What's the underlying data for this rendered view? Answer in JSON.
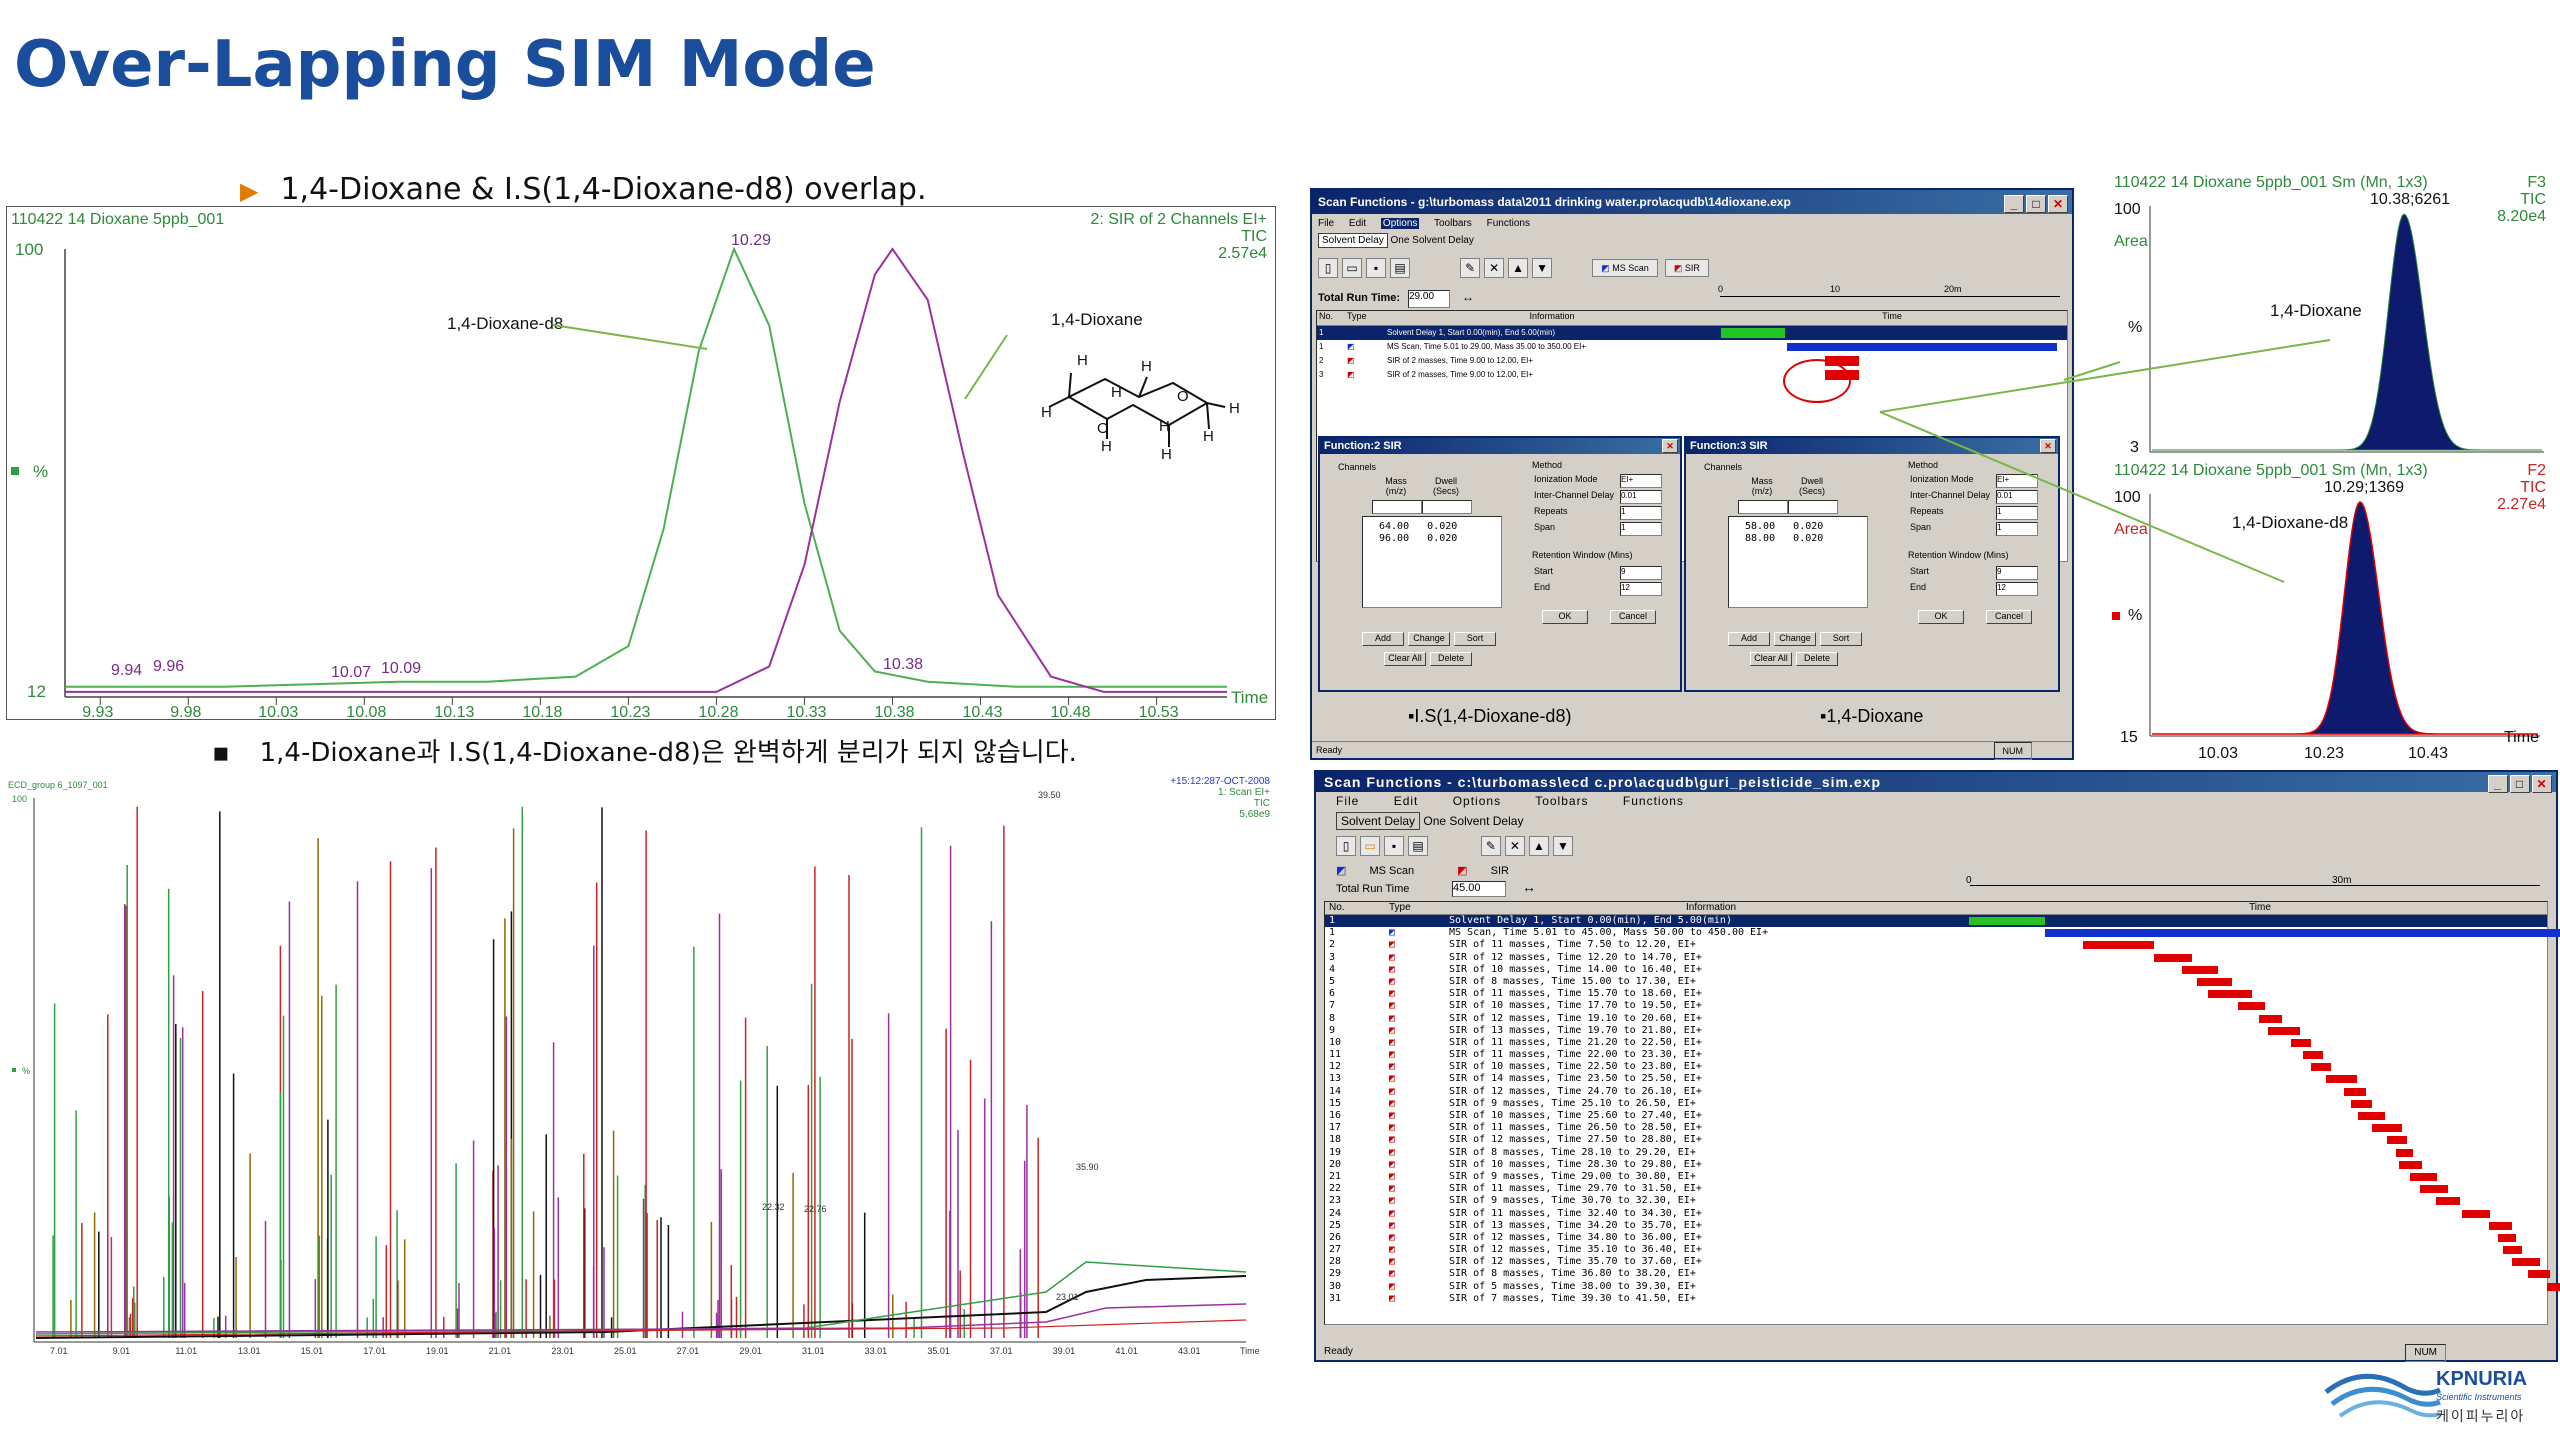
{
  "title": "Over-Lapping SIM Mode",
  "bullet1": "1,4-Dioxane & I.S(1,4-Dioxane-d8) overlap.",
  "bullet2": "1,4-Dioxane과 I.S(1,4-Dioxane-d8)은 완벽하게 분리가 되지 않습니다.",
  "colors": {
    "title": "#1a4d9c",
    "green": "#4caf50",
    "purple": "#9b30a0",
    "navy": "#0d1a6e",
    "red": "#e00000",
    "bar_blue": "#1030d0"
  },
  "chart1": {
    "header_left": "110422 14 Dioxane 5ppb_001",
    "header_right1": "2: SIR of 2 Channels EI+",
    "header_right2": "TIC",
    "header_right3": "2.57e4",
    "y_top": "100",
    "y_bottom": "12",
    "y_unit": "%",
    "x_label": "Time",
    "x_ticks": [
      "9.93",
      "9.98",
      "10.03",
      "10.08",
      "10.13",
      "10.18",
      "10.23",
      "10.28",
      "10.33",
      "10.38",
      "10.43",
      "10.48",
      "10.53"
    ],
    "peak_labels": [
      "10.29",
      "10.38",
      "9.94",
      "9.96",
      "10.07",
      "10.09"
    ],
    "annot_d8": "1,4-Dioxane-d8",
    "annot_diox": "1,4-Dioxane"
  },
  "chart_data": {
    "type": "line",
    "title": "",
    "xlabel": "Time",
    "ylabel": "%",
    "xlim": [
      9.91,
      10.57
    ],
    "ylim": [
      12,
      100
    ],
    "series": [
      {
        "name": "1,4-Dioxane-d8",
        "color": "#4caf50",
        "x": [
          9.91,
          10.0,
          10.1,
          10.15,
          10.2,
          10.23,
          10.25,
          10.27,
          10.29,
          10.31,
          10.33,
          10.35,
          10.37,
          10.4,
          10.45,
          10.5,
          10.57
        ],
        "y": [
          14,
          14,
          15,
          15,
          16,
          22,
          45,
          80,
          100,
          85,
          50,
          25,
          17,
          15,
          14,
          14,
          14
        ]
      },
      {
        "name": "1,4-Dioxane",
        "color": "#9b30a0",
        "x": [
          9.91,
          10.0,
          10.1,
          10.2,
          10.28,
          10.31,
          10.33,
          10.35,
          10.37,
          10.38,
          10.4,
          10.42,
          10.44,
          10.47,
          10.5,
          10.57
        ],
        "y": [
          13,
          13,
          13,
          13,
          13,
          18,
          38,
          70,
          95,
          100,
          90,
          60,
          32,
          16,
          13,
          13
        ]
      }
    ]
  },
  "scanwin1": {
    "title": "Scan Functions - g:\\turbomass data\\2011 drinking water.pro\\acqudb\\14dioxane.exp",
    "menus": [
      "File",
      "Edit",
      "Options",
      "Toolbars",
      "Functions"
    ],
    "solvent_btn": "Solvent Delay",
    "solvent_text": "One Solvent Delay",
    "ms_scan": "MS Scan",
    "sir": "SIR",
    "total_run_label": "Total Run Time:",
    "total_run_value": "29.00",
    "axis_10": "10",
    "axis_20": "20m",
    "axis_0": "0",
    "col_no": "No.",
    "col_type": "Type",
    "col_info": "Information",
    "col_time": "Time",
    "rows": [
      {
        "no": "1",
        "info": "Solvent Delay 1, Start 0.00(min), End 5.00(min)"
      },
      {
        "no": "1",
        "info": "MS Scan, Time 5.01 to 29.00, Mass 35.00 to 350.00 EI+"
      },
      {
        "no": "2",
        "info": "SIR of 2 masses, Time 9.00 to 12.00, EI+"
      },
      {
        "no": "3",
        "info": "SIR of 2 masses, Time 9.00 to 12.00, EI+"
      }
    ],
    "dlg2_title": "Function:2 SIR",
    "dlg3_title": "Function:3 SIR",
    "channels": "Channels",
    "mass": "Mass (m/z)",
    "dwell": "Dwell (Secs)",
    "dlg2_masses": [
      "64.00",
      "96.00"
    ],
    "dlg3_masses": [
      "58.00",
      "88.00"
    ],
    "dwell_value": "0.020",
    "method": "Method",
    "ion_mode": "Ionization Mode",
    "ion_value": "EI+",
    "interchannel": "Inter-Channel Delay",
    "interchannel_value": "0.01",
    "repeats": "Repeats",
    "span": "Span",
    "one": "1",
    "retention": "Retention Window (Mins)",
    "start": "Start",
    "end": "End",
    "start_value": "9",
    "end_value": "12",
    "add": "Add",
    "change": "Change",
    "sort": "Sort",
    "clear_all": "Clear All",
    "delete": "Delete",
    "ok": "OK",
    "cancel": "Cancel",
    "label_is": "▪I.S(1,4-Dioxane-d8)",
    "label_diox": "▪1,4-Dioxane",
    "status": "Ready",
    "num": "NUM"
  },
  "chart2": {
    "header_left": "110422 14 Dioxane 5ppb_001 Sm (Mn, 1x3)",
    "header_f": "F3",
    "header_tic": "TIC",
    "header_val": "8.20e4",
    "peak": "10.38;6261",
    "y_top": "100",
    "y_bottom": "3",
    "area": "Area",
    "pct": "%",
    "annot": "1,4-Dioxane"
  },
  "chart3": {
    "header_left": "110422 14 Dioxane 5ppb_001 Sm (Mn, 1x3)",
    "header_f": "F2",
    "header_tic": "TIC",
    "header_val": "2.27e4",
    "peak": "10.29;1369",
    "y_top": "100",
    "y_bottom": "15",
    "area": "Area",
    "pct": "%",
    "annot": "1,4-Dioxane-d8",
    "x_ticks": [
      "10.03",
      "10.23",
      "10.43"
    ],
    "x_label": "Time"
  },
  "chart4": {
    "header_left": "ECD_group 6_1097_001",
    "header_right1": "+15:12:287-OCT-2008",
    "header_right2": "1: Scan EI+",
    "header_right3": "TIC",
    "header_right4": "5.68e9",
    "y_top": "100",
    "y_unit": "%",
    "x_ticks": [
      "7.01",
      "9.01",
      "11.01",
      "13.01",
      "15.01",
      "17.01",
      "19.01",
      "21.01",
      "23.01",
      "25.01",
      "27.01",
      "29.01",
      "31.01",
      "33.01",
      "35.01",
      "37.01",
      "39.01",
      "41.01",
      "43.01"
    ],
    "x_label": "Time",
    "peak_labels": [
      "39.50",
      "35.90",
      "22.32",
      "22.76",
      "23.01"
    ]
  },
  "scanwin2": {
    "title": "Scan Functions - c:\\turbomass\\ecd c.pro\\acqudb\\guri_peisticide_sim.exp",
    "menus": [
      "File",
      "Edit",
      "Options",
      "Toolbars",
      "Functions"
    ],
    "solvent_btn": "Solvent Delay",
    "solvent_text": "One Solvent Delay",
    "ms_scan": "MS Scan",
    "sir": "SIR",
    "total_run_label": "Total Run Time",
    "total_run_value": "45.00",
    "axis_0": "0",
    "axis_30": "30m",
    "col_no": "No.",
    "col_type": "Type",
    "col_info": "Information",
    "col_time": "Time",
    "rows": [
      "Solvent Delay 1, Start 0.00(min), End 5.00(min)",
      "MS Scan, Time 5.01 to 45.00, Mass 50.00 to 450.00 EI+",
      "SIR of 11 masses, Time 7.50 to 12.20, EI+",
      "SIR of 12 masses, Time 12.20 to 14.70, EI+",
      "SIR of 10 masses, Time 14.00 to 16.40, EI+",
      "SIR of 8 masses, Time 15.00 to 17.30, EI+",
      "SIR of 11 masses, Time 15.70 to 18.60, EI+",
      "SIR of 10 masses, Time 17.70 to 19.50, EI+",
      "SIR of 12 masses, Time 19.10 to 20.60, EI+",
      "SIR of 13 masses, Time 19.70 to 21.80, EI+",
      "SIR of 11 masses, Time 21.20 to 22.50, EI+",
      "SIR of 11 masses, Time 22.00 to 23.30, EI+",
      "SIR of 10 masses, Time 22.50 to 23.80, EI+",
      "SIR of 14 masses, Time 23.50 to 25.50, EI+",
      "SIR of 12 masses, Time 24.70 to 26.10, EI+",
      "SIR of 9 masses, Time 25.10 to 26.50, EI+",
      "SIR of 10 masses, Time 25.60 to 27.40, EI+",
      "SIR of 11 masses, Time 26.50 to 28.50, EI+",
      "SIR of 12 masses, Time 27.50 to 28.80, EI+",
      "SIR of 8 masses, Time 28.10 to 29.20, EI+",
      "SIR of 10 masses, Time 28.30 to 29.80, EI+",
      "SIR of 9 masses, Time 29.00 to 30.80, EI+",
      "SIR of 11 masses, Time 29.70 to 31.50, EI+",
      "SIR of 9 masses, Time 30.70 to 32.30, EI+",
      "SIR of 11 masses, Time 32.40 to 34.30, EI+",
      "SIR of 13 masses, Time 34.20 to 35.70, EI+",
      "SIR of 12 masses, Time 34.80 to 36.00, EI+",
      "SIR of 12 masses, Time 35.10 to 36.40, EI+",
      "SIR of 12 masses, Time 35.70 to 37.60, EI+",
      "SIR of 8 masses, Time 36.80 to 38.20, EI+",
      "SIR of 5 masses, Time 38.00 to 39.30, EI+",
      "SIR of 7 masses, Time 39.30 to 41.50, EI+"
    ],
    "row_numbers": [
      "1",
      "1",
      "2",
      "3",
      "4",
      "5",
      "6",
      "7",
      "8",
      "9",
      "10",
      "11",
      "12",
      "13",
      "14",
      "15",
      "16",
      "17",
      "18",
      "19",
      "20",
      "21",
      "22",
      "23",
      "24",
      "25",
      "26",
      "27",
      "28",
      "29",
      "30",
      "31"
    ],
    "status": "Ready",
    "num": "NUM"
  },
  "logo": {
    "name": "KPNURIA",
    "sub": "Scientific Instruments",
    "korean": "케이피누리아"
  }
}
